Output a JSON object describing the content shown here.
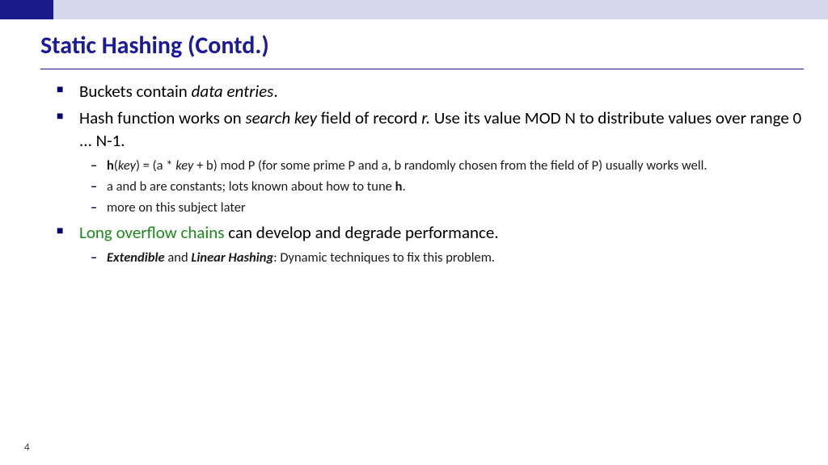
{
  "title": "Static Hashing (Contd.)",
  "bullets": {
    "b1": {
      "t1": "Buckets contain ",
      "t2": "data entries",
      "t3": "."
    },
    "b2": {
      "t1": "Hash function works on ",
      "t2": "search key",
      "t3": " field of record ",
      "t4": "r.",
      "t5": "  Use its value MOD N to distribute values over  range 0 ... N-1.",
      "sub": {
        "s1": {
          "t1": "h",
          "t2": "(",
          "t3": "key",
          "t4": ") = (a * ",
          "t5": "key",
          "t6": " + b) mod P (for some prime P and a, b randomly chosen from the field of P) usually works well."
        },
        "s2": {
          "t1": "a and b are constants;  lots known about how to tune ",
          "t2": "h",
          "t3": "."
        },
        "s3": {
          "t1": "more on this subject later"
        }
      }
    },
    "b3": {
      "t1": "Long overflow chains",
      "t2": " can develop and degrade performance.",
      "sub": {
        "s1": {
          "t1": "Extendible",
          "t2": " and ",
          "t3": "Linear Hashing",
          "t4": ": Dynamic techniques to fix this problem."
        }
      }
    }
  },
  "pageNumber": "4"
}
